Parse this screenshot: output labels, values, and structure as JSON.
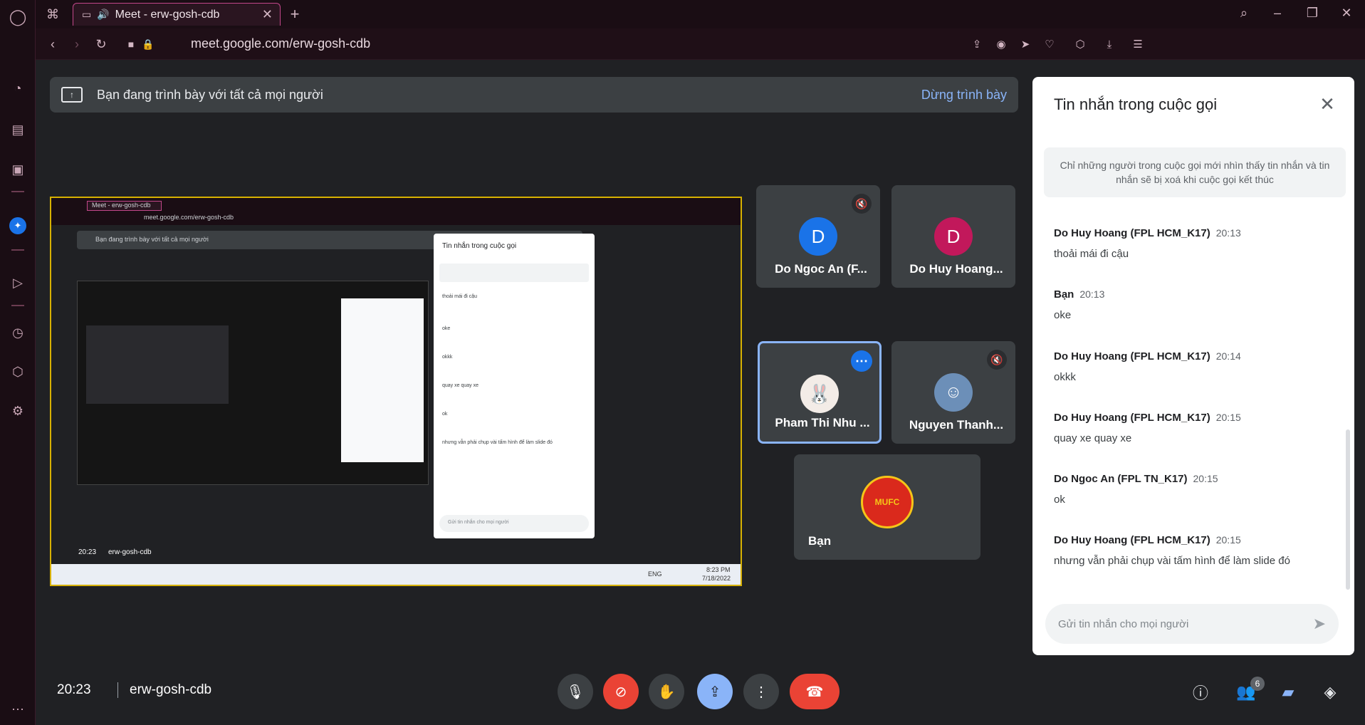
{
  "browser": {
    "tab_title": "Meet - erw-gosh-cdb",
    "url": "meet.google.com/erw-gosh-cdb"
  },
  "present_bar": {
    "text": "Bạn đang trình bày với tất cả mọi người",
    "stop_label": "Dừng trình bày"
  },
  "participants": [
    {
      "name": "Do Ngoc An (F...",
      "initial": "D",
      "color": "#1a73e8",
      "muted": true
    },
    {
      "name": "Do Huy Hoang...",
      "initial": "D",
      "color": "#c2185b",
      "muted": false
    },
    {
      "name": "Pham Thi Nhu ...",
      "initial": "",
      "color": "#ffffff",
      "muted": false
    },
    {
      "name": "Nguyen Thanh...",
      "initial": "",
      "color": "#6c8fb8",
      "muted": true
    },
    {
      "name": "Bạn",
      "initial": "",
      "color": "#c8102e",
      "muted": false
    }
  ],
  "chat": {
    "title": "Tin nhắn trong cuộc gọi",
    "notice": "Chỉ những người trong cuộc gọi mới nhìn thấy tin nhắn và tin nhắn sẽ bị xoá khi cuộc gọi kết thúc",
    "messages": [
      {
        "author": "Do Huy Hoang (FPL HCM_K17)",
        "time": "20:13",
        "text": "thoải mái đi cậu"
      },
      {
        "author": "Bạn",
        "time": "20:13",
        "text": "oke"
      },
      {
        "author": "Do Huy Hoang (FPL HCM_K17)",
        "time": "20:14",
        "text": "okkk"
      },
      {
        "author": "Do Huy Hoang (FPL HCM_K17)",
        "time": "20:15",
        "text": "quay xe quay xe"
      },
      {
        "author": "Do Ngoc An (FPL TN_K17)",
        "time": "20:15",
        "text": "ok"
      },
      {
        "author": "Do Huy Hoang (FPL HCM_K17)",
        "time": "20:15",
        "text": "nhưng vẫn phải chụp vài tấm hình để làm slide đó"
      }
    ],
    "input_placeholder": "Gửi tin nhắn cho mọi người"
  },
  "bottom": {
    "time": "20:23",
    "meeting_code": "erw-gosh-cdb",
    "people_count": "6"
  },
  "preview": {
    "time": "20:23",
    "meeting_code": "erw-gosh-cdb",
    "taskbar_time": "8:23 PM",
    "taskbar_date": "7/18/2022",
    "taskbar_lang": "ENG"
  },
  "colors": {
    "accent": "#8ab4f8",
    "danger": "#ea4335",
    "tile": "#3c4043",
    "background": "#202124"
  }
}
